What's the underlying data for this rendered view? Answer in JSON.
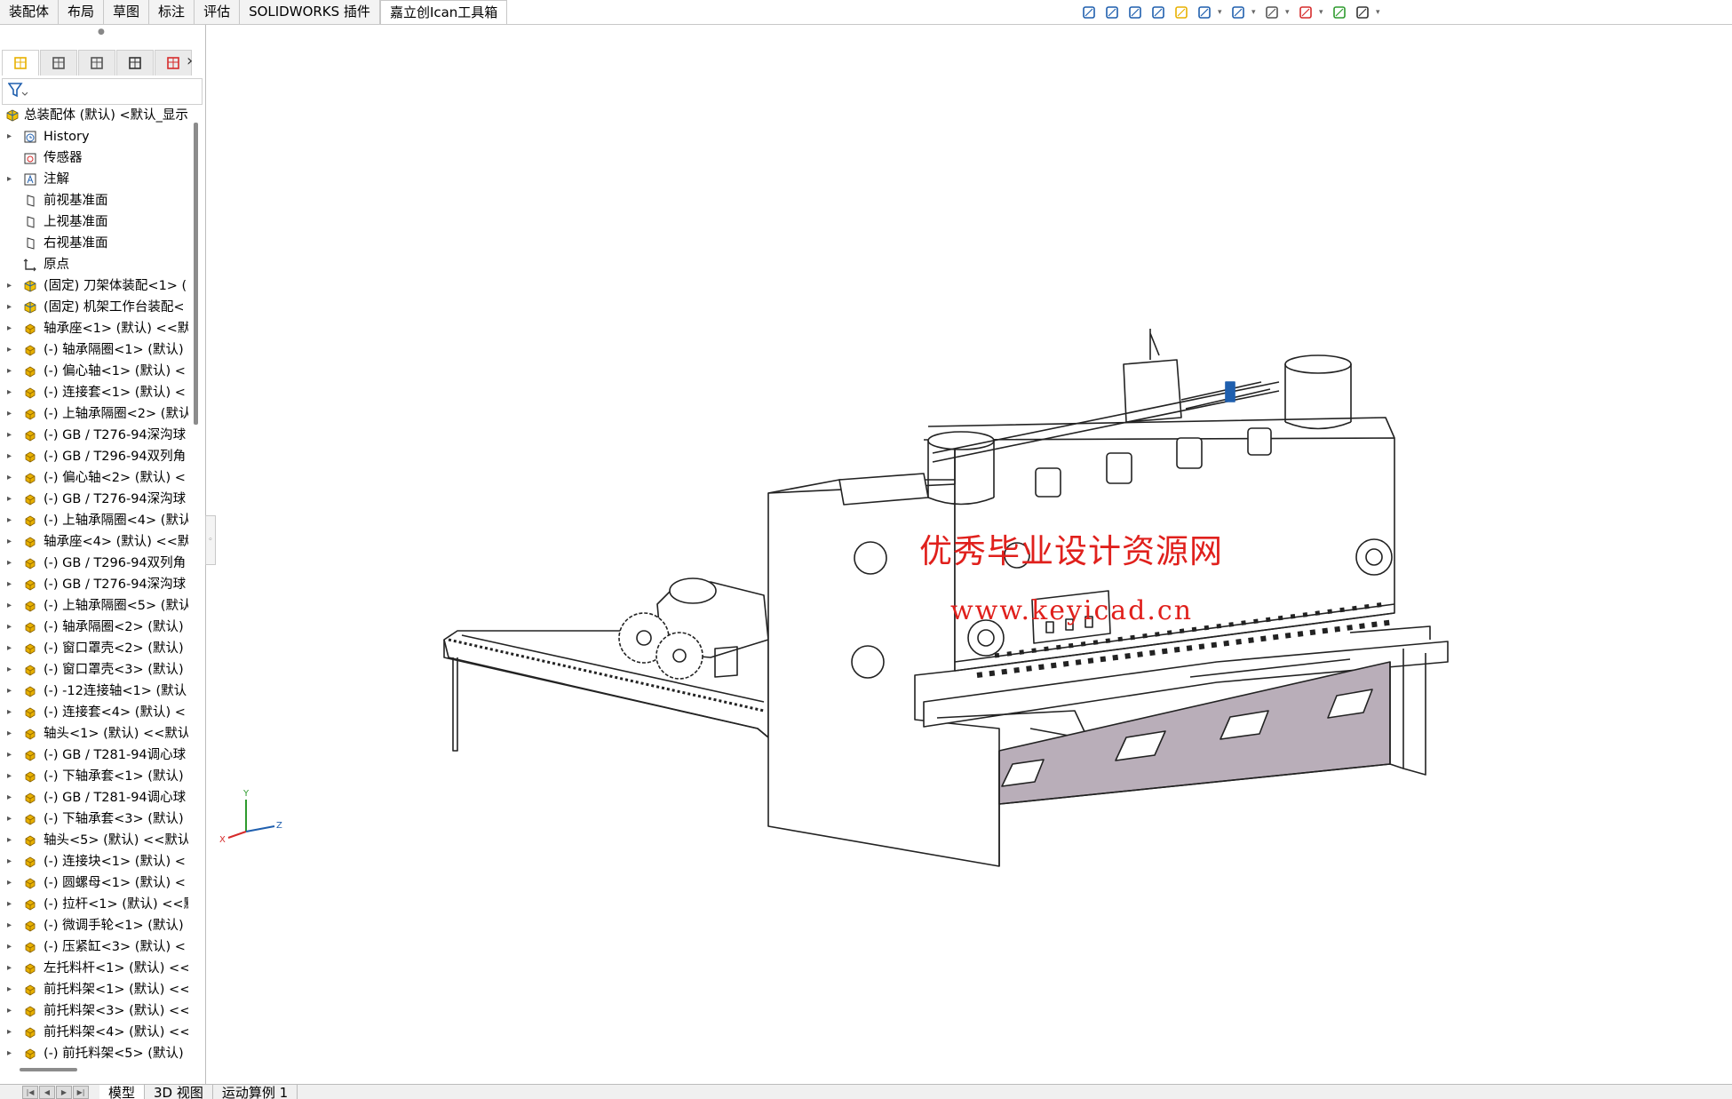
{
  "command_tabs": [
    "装配体",
    "布局",
    "草图",
    "标注",
    "评估",
    "SOLIDWORKS 插件",
    "嘉立创Ican工具箱"
  ],
  "active_command_tab": 6,
  "hud_icons": [
    "zoom-to-fit-icon",
    "zoom-to-area-icon",
    "previous-view-icon",
    "section-view-icon",
    "dynamic-annotation-icon",
    "view-orientation-icon",
    "display-style-icon",
    "hide-show-items-icon",
    "edit-appearance-icon",
    "apply-scene-icon",
    "view-settings-icon"
  ],
  "panel_tabs": [
    "featuremanager-tab",
    "propertymanager-tab",
    "configurationmanager-tab",
    "dimxpert-tab",
    "display-manager-tab"
  ],
  "tree": {
    "root": "总装配体 (默认) <默认_显示",
    "items": [
      {
        "label": "History",
        "icon": "history",
        "exp": true
      },
      {
        "label": "传感器",
        "icon": "sensor",
        "exp": false
      },
      {
        "label": "注解",
        "icon": "annotation",
        "exp": true
      },
      {
        "label": "前视基准面",
        "icon": "plane",
        "exp": false
      },
      {
        "label": "上视基准面",
        "icon": "plane",
        "exp": false
      },
      {
        "label": "右视基准面",
        "icon": "plane",
        "exp": false
      },
      {
        "label": "原点",
        "icon": "origin",
        "exp": false
      },
      {
        "label": "(固定) 刀架体装配<1> (",
        "icon": "assembly",
        "exp": true
      },
      {
        "label": "(固定) 机架工作台装配<",
        "icon": "assembly",
        "exp": true
      },
      {
        "label": "轴承座<1> (默认) <<默",
        "icon": "part",
        "exp": true
      },
      {
        "label": "(-) 轴承隔圈<1> (默认)",
        "icon": "part",
        "exp": true
      },
      {
        "label": "(-) 偏心轴<1> (默认) <",
        "icon": "part",
        "exp": true
      },
      {
        "label": "(-) 连接套<1> (默认) <",
        "icon": "part",
        "exp": true
      },
      {
        "label": "(-) 上轴承隔圈<2> (默认",
        "icon": "part",
        "exp": true
      },
      {
        "label": "(-) GB / T276-94深沟球",
        "icon": "part",
        "exp": true
      },
      {
        "label": "(-) GB / T296-94双列角",
        "icon": "part",
        "exp": true
      },
      {
        "label": "(-) 偏心轴<2> (默认) <",
        "icon": "part",
        "exp": true
      },
      {
        "label": "(-) GB / T276-94深沟球",
        "icon": "part",
        "exp": true
      },
      {
        "label": "(-) 上轴承隔圈<4> (默认",
        "icon": "part",
        "exp": true
      },
      {
        "label": "轴承座<4> (默认) <<默",
        "icon": "part",
        "exp": true
      },
      {
        "label": "(-) GB / T296-94双列角",
        "icon": "part",
        "exp": true
      },
      {
        "label": "(-) GB / T276-94深沟球",
        "icon": "part",
        "exp": true
      },
      {
        "label": "(-) 上轴承隔圈<5> (默认",
        "icon": "part",
        "exp": true
      },
      {
        "label": "(-) 轴承隔圈<2> (默认)",
        "icon": "part",
        "exp": true
      },
      {
        "label": "(-) 窗口罩壳<2> (默认)",
        "icon": "part",
        "exp": true
      },
      {
        "label": "(-) 窗口罩壳<3> (默认)",
        "icon": "part",
        "exp": true
      },
      {
        "label": "(-) -12连接轴<1> (默认",
        "icon": "part",
        "exp": true
      },
      {
        "label": "(-) 连接套<4> (默认) <",
        "icon": "part",
        "exp": true
      },
      {
        "label": "轴头<1> (默认) <<默认",
        "icon": "part",
        "exp": true
      },
      {
        "label": "(-) GB / T281-94调心球",
        "icon": "part",
        "exp": true
      },
      {
        "label": "(-) 下轴承套<1> (默认)",
        "icon": "part",
        "exp": true
      },
      {
        "label": "(-) GB / T281-94调心球",
        "icon": "part",
        "exp": true
      },
      {
        "label": "(-) 下轴承套<3> (默认)",
        "icon": "part",
        "exp": true
      },
      {
        "label": "轴头<5> (默认) <<默认",
        "icon": "part",
        "exp": true
      },
      {
        "label": "(-) 连接块<1> (默认) <",
        "icon": "part",
        "exp": true
      },
      {
        "label": "(-) 圆螺母<1> (默认) <",
        "icon": "part",
        "exp": true
      },
      {
        "label": "(-) 拉杆<1> (默认) <<默",
        "icon": "part",
        "exp": true
      },
      {
        "label": "(-) 微调手轮<1> (默认)",
        "icon": "part",
        "exp": true
      },
      {
        "label": "(-) 压紧缸<3> (默认) <",
        "icon": "part",
        "exp": true
      },
      {
        "label": "左托料杆<1> (默认) <<",
        "icon": "part",
        "exp": true
      },
      {
        "label": "前托料架<1> (默认) <<",
        "icon": "part",
        "exp": true
      },
      {
        "label": "前托料架<3> (默认) <<",
        "icon": "part",
        "exp": true
      },
      {
        "label": "前托料架<4> (默认) <<",
        "icon": "part",
        "exp": true
      },
      {
        "label": "(-) 前托料架<5> (默认)",
        "icon": "part",
        "exp": true
      }
    ]
  },
  "watermark": {
    "line1": "优秀毕业设计资源网",
    "line2": "www.keyicad.cn",
    "color": "#e0201c"
  },
  "triad": {
    "x": "X",
    "y": "Y",
    "z": "Z"
  },
  "bottom_tabs": [
    "模型",
    "3D 视图",
    "运动算例 1"
  ],
  "active_bottom_tab": 0,
  "colors": {
    "part_icon": "#e8b100",
    "accent_blue": "#1f5fae",
    "window_fill": "#b9aeb9"
  }
}
